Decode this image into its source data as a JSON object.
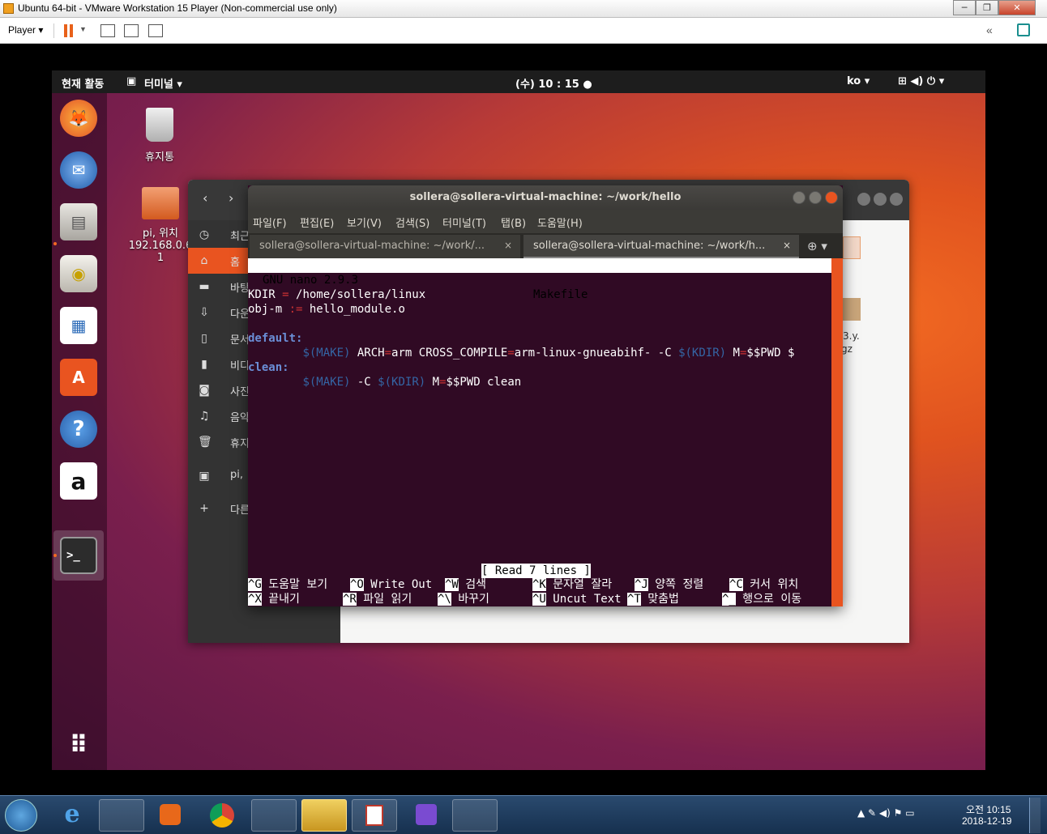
{
  "vmware": {
    "title": "Ubuntu 64-bit - VMware Workstation 15 Player (Non-commercial use only)",
    "player_menu": "Player ▾",
    "minimize": "─",
    "restore": "❐",
    "close": "✕",
    "collapse": "«",
    "accent": "#e8611a"
  },
  "topbar": {
    "activities": "현재 활동",
    "app_menu": "터미널 ▾",
    "clock": "(수) 10 : 15 ●",
    "lang": "ko ▾",
    "status_icons": "⊞  ◀)  ⏻ ▾"
  },
  "desktop": {
    "trash_label": "휴지통",
    "share_label_1": "pi, 위치",
    "share_label_2": "192.168.0.6",
    "share_label_3": "1"
  },
  "dock": {
    "apps": [
      {
        "name": "firefox",
        "glyph": "🦊"
      },
      {
        "name": "thunderbird",
        "glyph": "✉"
      },
      {
        "name": "files",
        "glyph": "▤"
      },
      {
        "name": "rhythmbox",
        "glyph": "◉"
      },
      {
        "name": "writer",
        "glyph": "▦"
      },
      {
        "name": "software",
        "glyph": "A"
      },
      {
        "name": "help",
        "glyph": "?"
      },
      {
        "name": "amazon",
        "glyph": "a"
      },
      {
        "name": "terminal",
        "glyph": ">_"
      }
    ],
    "show_apps": "⠿"
  },
  "files": {
    "sidebar": [
      {
        "icon": "◷",
        "label": "최근"
      },
      {
        "icon": "⌂",
        "label": "홈"
      },
      {
        "icon": "▬",
        "label": "바탕"
      },
      {
        "icon": "⇩",
        "label": "다운"
      },
      {
        "icon": "▯",
        "label": "문서"
      },
      {
        "icon": "▮",
        "label": "비디"
      },
      {
        "icon": "◙",
        "label": "사진"
      },
      {
        "icon": "♫",
        "label": "음악"
      },
      {
        "icon": "🗑",
        "label": "휴지"
      },
      {
        "icon": "▣",
        "label": "pi,"
      },
      {
        "icon": "+",
        "label": "다른"
      }
    ],
    "file_frag_1": "3.y.",
    "file_frag_2": "gz"
  },
  "terminal": {
    "title": "sollera@sollera-virtual-machine: ~/work/hello",
    "menu": [
      "파일(F)",
      "편집(E)",
      "보기(V)",
      "검색(S)",
      "터미널(T)",
      "탭(B)",
      "도움말(H)"
    ],
    "tabs": [
      {
        "label": "sollera@sollera-virtual-machine: ~/work/...",
        "close": "×"
      },
      {
        "label": "sollera@sollera-virtual-machine: ~/work/h...",
        "close": "×"
      }
    ],
    "new_tab": "⊕ ▾"
  },
  "nano": {
    "version": "GNU nano 2.9.3",
    "filename": "Makefile",
    "status": "[ Read 7 lines ]",
    "lines": {
      "l1_a": "KDIR",
      "l1_b": " = ",
      "l1_c": "/home/sollera/linux",
      "l2_a": "obj-m",
      "l2_b": " := ",
      "l2_c": "hello_module.o",
      "l4": "default:",
      "l5_a": "        ",
      "l5_b": "$(MAKE)",
      "l5_c": " ARCH",
      "l5_d": "=",
      "l5_e": "arm CROSS_COMPILE",
      "l5_f": "=",
      "l5_g": "arm-linux-gnueabihf- -C ",
      "l5_h": "$(KDIR)",
      "l5_i": " M",
      "l5_j": "=",
      "l5_k": "$$PWD $",
      "l6": "clean:",
      "l7_a": "        ",
      "l7_b": "$(MAKE)",
      "l7_c": " -C ",
      "l7_d": "$(KDIR)",
      "l7_e": " M",
      "l7_f": "=",
      "l7_g": "$$PWD clean"
    },
    "shortcuts": [
      {
        "key": "^G",
        "label": " 도움말 보기"
      },
      {
        "key": "^O",
        "label": " Write Out"
      },
      {
        "key": "^W",
        "label": " 검색"
      },
      {
        "key": "^K",
        "label": " 문자열 잘라"
      },
      {
        "key": "^J",
        "label": " 양쪽 정렬"
      },
      {
        "key": "^C",
        "label": " 커서 위치"
      },
      {
        "key": "^X",
        "label": " 끝내기"
      },
      {
        "key": "^R",
        "label": " 파일 읽기"
      },
      {
        "key": "^\\",
        "label": " 바꾸기"
      },
      {
        "key": "^U",
        "label": " Uncut Text"
      },
      {
        "key": "^T",
        "label": " 맞춤법"
      },
      {
        "key": "^_",
        "label": " 행으로 이동"
      }
    ]
  },
  "taskbar": {
    "time": "오전 10:15",
    "date": "2018-12-19"
  }
}
